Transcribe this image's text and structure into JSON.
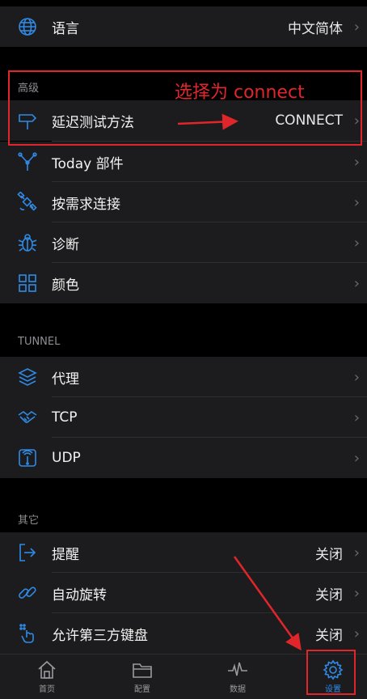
{
  "rows": {
    "language": {
      "label": "语言",
      "value": "中文简体",
      "icon": "globe-icon"
    },
    "delay_test": {
      "label": "延迟测试方法",
      "value": "CONNECT",
      "icon": "signpost-icon"
    },
    "today_widget": {
      "label": "Today 部件",
      "icon": "network-icon"
    },
    "on_demand": {
      "label": "按需求连接",
      "icon": "satellite-icon"
    },
    "diagnose": {
      "label": "诊断",
      "icon": "bug-icon"
    },
    "color": {
      "label": "颜色",
      "icon": "grid-icon"
    },
    "proxy": {
      "label": "代理",
      "icon": "layers-icon"
    },
    "tcp": {
      "label": "TCP",
      "icon": "handshake-icon"
    },
    "udp": {
      "label": "UDP",
      "icon": "udp-icon"
    },
    "reminder": {
      "label": "提醒",
      "value": "关闭",
      "icon": "exit-icon"
    },
    "auto_rotate": {
      "label": "自动旋转",
      "value": "关闭",
      "icon": "link-icon"
    },
    "third_keyboard": {
      "label": "允许第三方键盘",
      "value": "关闭",
      "icon": "keyboard-hand-icon"
    }
  },
  "sections": {
    "advanced": "高级",
    "tunnel": "TUNNEL",
    "other": "其它"
  },
  "annotation": {
    "text": "选择为 connect",
    "color": "#e0262b"
  },
  "tabs": [
    {
      "label": "首页",
      "icon": "home-icon"
    },
    {
      "label": "配置",
      "icon": "folder-icon"
    },
    {
      "label": "数据",
      "icon": "pulse-icon"
    },
    {
      "label": "设置",
      "icon": "gear-icon",
      "active": true
    }
  ],
  "chevron": "›",
  "colors": {
    "accent": "#2f8ae6",
    "annotation": "#e0262b",
    "row_bg": "#1c1c1e"
  }
}
